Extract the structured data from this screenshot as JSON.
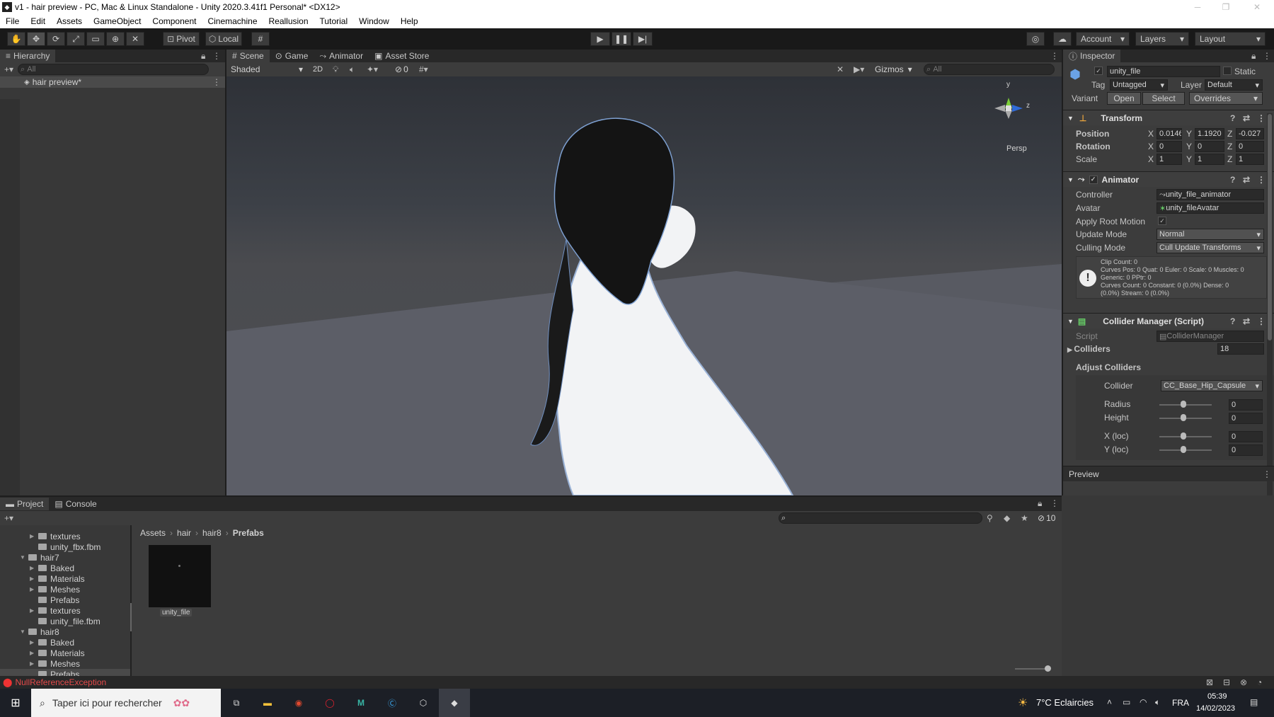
{
  "window": {
    "title": "v1 - hair preview - PC, Mac & Linux Standalone - Unity 2020.3.41f1 Personal* <DX12>"
  },
  "menu": [
    "File",
    "Edit",
    "Assets",
    "GameObject",
    "Component",
    "Cinemachine",
    "Reallusion",
    "Tutorial",
    "Window",
    "Help"
  ],
  "toolbar": {
    "pivot": "Pivot",
    "local": "Local",
    "account": "Account",
    "layers": "Layers",
    "layout": "Layout"
  },
  "hierarchy": {
    "tab": "Hierarchy",
    "search_placeholder": "All",
    "root": "hair preview*"
  },
  "scene": {
    "tabs": [
      "Scene",
      "Game",
      "Animator",
      "Asset Store"
    ],
    "shading": "Shaded",
    "twod": "2D",
    "hidden_count": "0",
    "gizmos": "Gizmos",
    "search_placeholder": "All",
    "persp": "Persp",
    "gizmo_y": "y",
    "gizmo_z": "z"
  },
  "inspector": {
    "tab": "Inspector",
    "object_name": "unity_file",
    "static": "Static",
    "tag_label": "Tag",
    "tag": "Untagged",
    "layer_label": "Layer",
    "layer": "Default",
    "variant_label": "Variant",
    "open": "Open",
    "select": "Select",
    "overrides": "Overrides",
    "transform": {
      "title": "Transform",
      "position": "Position",
      "rotation": "Rotation",
      "scale": "Scale",
      "pos": [
        "0.0146",
        "1.1920",
        "-0.027"
      ],
      "rot": [
        "0",
        "0",
        "0"
      ],
      "scl": [
        "1",
        "1",
        "1"
      ]
    },
    "animator": {
      "title": "Animator",
      "controller_label": "Controller",
      "controller": "unity_file_animator",
      "avatar_label": "Avatar",
      "avatar": "unity_fileAvatar",
      "root_motion": "Apply Root Motion",
      "update_label": "Update Mode",
      "update": "Normal",
      "culling_label": "Culling Mode",
      "culling": "Cull Update Transforms",
      "info": [
        "Clip Count: 0",
        "Curves Pos: 0 Quat: 0 Euler: 0 Scale: 0 Muscles: 0",
        "Generic: 0 PPtr: 0",
        "Curves Count: 0 Constant: 0 (0.0%) Dense: 0",
        "(0.0%) Stream: 0 (0.0%)"
      ]
    },
    "collider": {
      "title": "Collider Manager (Script)",
      "script_label": "Script",
      "script": "ColliderManager",
      "colliders_label": "Colliders",
      "colliders": "18",
      "adjust": "Adjust Colliders",
      "collider_label": "Collider",
      "collider": "CC_Base_Hip_Capsule",
      "radius": "Radius",
      "height": "Height",
      "xloc": "X (loc)",
      "yloc": "Y (loc)",
      "radius_v": "0",
      "height_v": "0",
      "xloc_v": "0",
      "yloc_v": "0"
    },
    "preview": "Preview"
  },
  "project": {
    "tabs": [
      "Project",
      "Console"
    ],
    "count": "10",
    "tree": [
      {
        "label": "textures",
        "indent": 2,
        "arrow": "▶"
      },
      {
        "label": "unity_fbx.fbm",
        "indent": 2,
        "arrow": ""
      },
      {
        "label": "hair7",
        "indent": 1,
        "arrow": "▼"
      },
      {
        "label": "Baked",
        "indent": 2,
        "arrow": "▶"
      },
      {
        "label": "Materials",
        "indent": 2,
        "arrow": "▶"
      },
      {
        "label": "Meshes",
        "indent": 2,
        "arrow": "▶"
      },
      {
        "label": "Prefabs",
        "indent": 2,
        "arrow": ""
      },
      {
        "label": "textures",
        "indent": 2,
        "arrow": "▶"
      },
      {
        "label": "unity_file.fbm",
        "indent": 2,
        "arrow": ""
      },
      {
        "label": "hair8",
        "indent": 1,
        "arrow": "▼"
      },
      {
        "label": "Baked",
        "indent": 2,
        "arrow": "▶"
      },
      {
        "label": "Materials",
        "indent": 2,
        "arrow": "▶"
      },
      {
        "label": "Meshes",
        "indent": 2,
        "arrow": "▶"
      },
      {
        "label": "Prefabs",
        "indent": 2,
        "arrow": ""
      }
    ],
    "breadcrumb": [
      "Assets",
      "hair",
      "hair8",
      "Prefabs"
    ],
    "asset": "unity_file"
  },
  "status": {
    "error": "NullReferenceException"
  },
  "taskbar": {
    "search": "Taper ici pour rechercher",
    "weather": "7°C  Eclaircies",
    "lang": "FRA",
    "time": "05:39",
    "date": "14/02/2023"
  }
}
